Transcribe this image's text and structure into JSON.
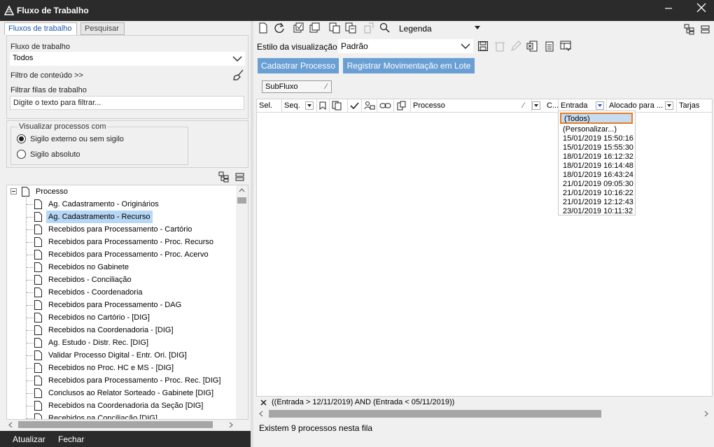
{
  "window": {
    "title": "Fluxo de Trabalho"
  },
  "left": {
    "tabs": [
      {
        "label": "Fluxos de trabalho",
        "active": true
      },
      {
        "label": "Pesquisar",
        "active": false
      }
    ],
    "workflow_label": "Fluxo de trabalho",
    "workflow_value": "Todos",
    "content_filter_label": "Filtro de conteúdo >>",
    "queue_filter_label": "Filtrar filas de trabalho",
    "queue_filter_value": "Digite o texto para filtrar...",
    "view_group": {
      "title": "Visualizar processos com",
      "options": [
        {
          "label": "Sigilo externo ou sem sigilo",
          "selected": true
        },
        {
          "label": "Sigilo absoluto",
          "selected": false
        }
      ]
    },
    "tree": {
      "root": "Processo",
      "items": [
        "Ag. Cadastramento - Originários",
        "Ag. Cadastramento - Recurso",
        "Recebidos para Processamento - Cartório",
        "Recebidos para Processamento - Proc. Recurso",
        "Recebidos para Processamento - Proc. Acervo",
        "Recebidos no Gabinete",
        "Recebidos - Conciliação",
        "Recebidos - Coordenadoria",
        "Recebidos para Processamento - DAG",
        "Recebidos no Cartório - [DIG]",
        "Recebidos na Coordenadoria - [DIG]",
        "Ag. Estudo - Distr. Rec. [DIG]",
        "Validar Processo Digital - Entr. Ori. [DIG]",
        "Recebidos no Proc. HC e MS - [DIG]",
        "Recebidos para Processamento - Proc. Rec. [DIG]",
        "Conclusos ao Relator Sorteado - Gabinete [DIG]",
        "Recebidos na Coordenadoria da Seção [DIG]",
        "Recebidos na Conciliação [DIG]"
      ],
      "selected_index": 1
    },
    "bottom": {
      "refresh_label": "Atualizar",
      "close_label": "Fechar"
    }
  },
  "right": {
    "legend_label": "Legenda",
    "view_style_label": "Estilo da visualização",
    "view_style_value": "Padrão",
    "buttons": {
      "register_process": "Cadastrar Processo",
      "register_batch": "Registrar Movimentação em Lote"
    },
    "group_chip": "SubFluxo",
    "columns": {
      "sel": "Sel.",
      "seq": "Seq.",
      "process": "Processo",
      "c": "C...",
      "entry": "Entrada",
      "allocated": "Alocado para ...",
      "tags": "Tarjas"
    },
    "entry_filter_options": [
      "(Todos)",
      "(Personalizar...)",
      "15/01/2019 15:50:16",
      "15/01/2019 15:55:30",
      "18/01/2019 16:12:32",
      "18/01/2019 16:14:48",
      "18/01/2019 16:43:24",
      "21/01/2019 09:05:30",
      "21/01/2019 10:16:22",
      "21/01/2019 12:12:43",
      "23/01/2019 10:11:32"
    ],
    "active_filter": "((Entrada > 12/11/2019) AND (Entrada < 05/11/2019))",
    "status": "Existem 9 processos nesta fila"
  }
}
